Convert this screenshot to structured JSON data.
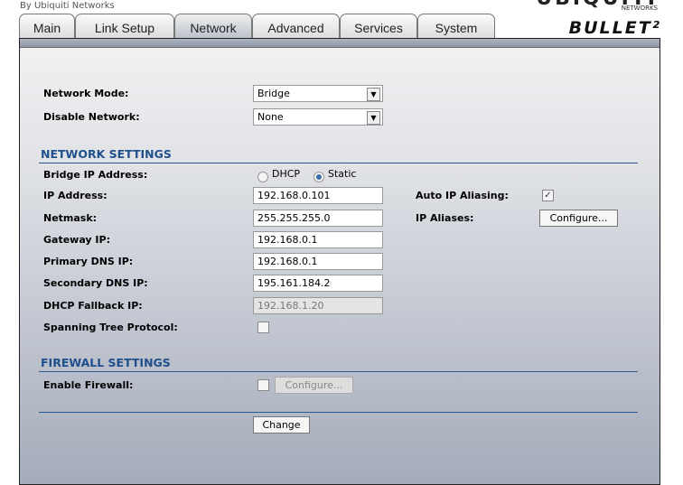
{
  "brand": {
    "byline": "By Ubiquiti Networks",
    "logo": "UBIQUITI",
    "logo_sub": "NETWORKS",
    "product": "BULLET²"
  },
  "tabs": [
    {
      "label": "Main"
    },
    {
      "label": "Link Setup"
    },
    {
      "label": "Network"
    },
    {
      "label": "Advanced"
    },
    {
      "label": "Services"
    },
    {
      "label": "System"
    }
  ],
  "form": {
    "network_mode": {
      "label": "Network Mode:",
      "value": "Bridge"
    },
    "disable_network": {
      "label": "Disable Network:",
      "value": "None"
    },
    "network_settings": {
      "title": "NETWORK SETTINGS",
      "bridge_ip": {
        "label": "Bridge IP Address:",
        "dhcp": "DHCP",
        "static": "Static",
        "selected": "Static"
      },
      "ip": {
        "label": "IP Address:",
        "value": "192.168.0.101"
      },
      "netmask": {
        "label": "Netmask:",
        "value": "255.255.255.0"
      },
      "gateway": {
        "label": "Gateway IP:",
        "value": "192.168.0.1"
      },
      "dns1": {
        "label": "Primary DNS IP:",
        "value": "192.168.0.1"
      },
      "dns2": {
        "label": "Secondary DNS IP:",
        "value": "195.161.184.2"
      },
      "fallback": {
        "label": "DHCP Fallback IP:",
        "value": "192.168.1.20"
      },
      "stp": {
        "label": "Spanning Tree Protocol:",
        "checked": false
      },
      "auto_alias": {
        "label": "Auto IP Aliasing:",
        "checked": true
      },
      "aliases": {
        "label": "IP Aliases:",
        "button": "Configure..."
      }
    },
    "firewall": {
      "title": "FIREWALL SETTINGS",
      "enable": {
        "label": "Enable Firewall:",
        "checked": false
      },
      "button": "Configure..."
    },
    "change": "Change"
  }
}
